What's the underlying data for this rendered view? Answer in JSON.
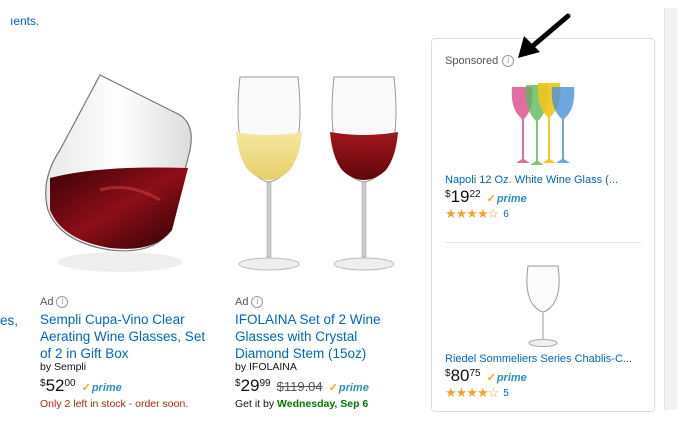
{
  "top_fragment": "ıents.",
  "left_edge_fragment": "es,",
  "products": [
    {
      "ad_label": "Ad",
      "title": "Sempli Cupa-Vino Clear Aerating Wine Glasses, Set of 2 in Gift Box",
      "brand": "by Sempli",
      "price_symbol": "$",
      "price_whole": "52",
      "price_fraction": "00",
      "prime_label": "prime",
      "stock_notice": "Only 2 left in stock - order soon."
    },
    {
      "ad_label": "Ad",
      "title": "IFOLAINA Set of 2 Wine Glasses with Crystal Diamond Stem (15oz)",
      "brand": "by IFOLAINA",
      "price_symbol": "$",
      "price_whole": "29",
      "price_fraction": "99",
      "list_price": "$119.04",
      "prime_label": "prime",
      "delivery_prefix": "Get it by",
      "delivery_date": "Wednesday, Sep 6"
    }
  ],
  "sponsored": {
    "label": "Sponsored",
    "items": [
      {
        "title": "Napoli 12 Oz. White Wine Glass (...",
        "price_symbol": "$",
        "price_whole": "19",
        "price_fraction": "22",
        "prime_label": "prime",
        "stars": "★★★★☆",
        "rating_value": 4,
        "review_count": "6"
      },
      {
        "title": "Riedel Sommeliers Series Chablis-C...",
        "price_symbol": "$",
        "price_whole": "80",
        "price_fraction": "75",
        "prime_label": "prime",
        "stars": "★★★★☆",
        "rating_value": 4,
        "review_count": "5"
      }
    ]
  },
  "colors": {
    "link": "#0066c0",
    "prime": "#2a8ebf",
    "stars": "#f2a32b",
    "stock": "#b12704",
    "delivery": "#007600"
  }
}
